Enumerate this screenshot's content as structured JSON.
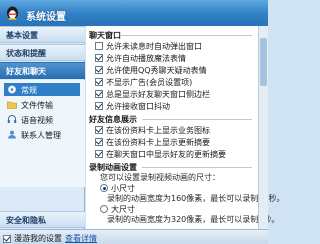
{
  "window": {
    "title": "系统设置"
  },
  "sidebar": {
    "categories": [
      {
        "label": "基本设置"
      },
      {
        "label": "状态和提醒"
      },
      {
        "label": "好友和聊天"
      }
    ],
    "subitems": [
      {
        "label": "常规",
        "icon": "gear-icon"
      },
      {
        "label": "文件传输",
        "icon": "folder-icon"
      },
      {
        "label": "语音视频",
        "icon": "headset-icon"
      },
      {
        "label": "联系人管理",
        "icon": "contacts-icon"
      }
    ],
    "bottom_category": {
      "label": "安全和隐私"
    }
  },
  "chat_window": {
    "title": "聊天窗口",
    "options": [
      {
        "label": "允许未读息时自动弹出窗口",
        "checked": false
      },
      {
        "label": "允许自动播放魔法表情",
        "checked": true
      },
      {
        "label": "允许使用QQ秀聊天疑动表情",
        "checked": true
      },
      {
        "label": "不显示广告(会员设置项)",
        "checked": true
      },
      {
        "label": "总是显示好友聊天窗口侧边栏",
        "checked": true
      },
      {
        "label": "允许接收窗口抖动",
        "checked": true
      }
    ]
  },
  "friend_info": {
    "title": "好友信息展示",
    "options": [
      {
        "label": "在该份资料卡上显示业务图标",
        "checked": true
      },
      {
        "label": "在该份资料卡上显示更新摘要",
        "checked": true
      },
      {
        "label": "在聊天窗口中显示好友的更新摘要",
        "checked": true
      }
    ]
  },
  "recording": {
    "title": "录制动画设置",
    "prompt": "您可以设置录制视频动画的尺寸：",
    "options": [
      {
        "label": "小尺寸",
        "description": "录制的动画宽度为160像素，最长可以录制10秒。",
        "selected": true
      },
      {
        "label": "大尺寸",
        "description": "录制的动画宽度为320像素，最长可以录制5秒。",
        "selected": false
      }
    ]
  },
  "footer": {
    "checkbox_label": "漫游我的设置",
    "checked": true,
    "link_label": "查看详情"
  },
  "colors": {
    "accent": "#2f7fc6",
    "titlebar": "#3a86cc",
    "link": "#1a56a8"
  }
}
